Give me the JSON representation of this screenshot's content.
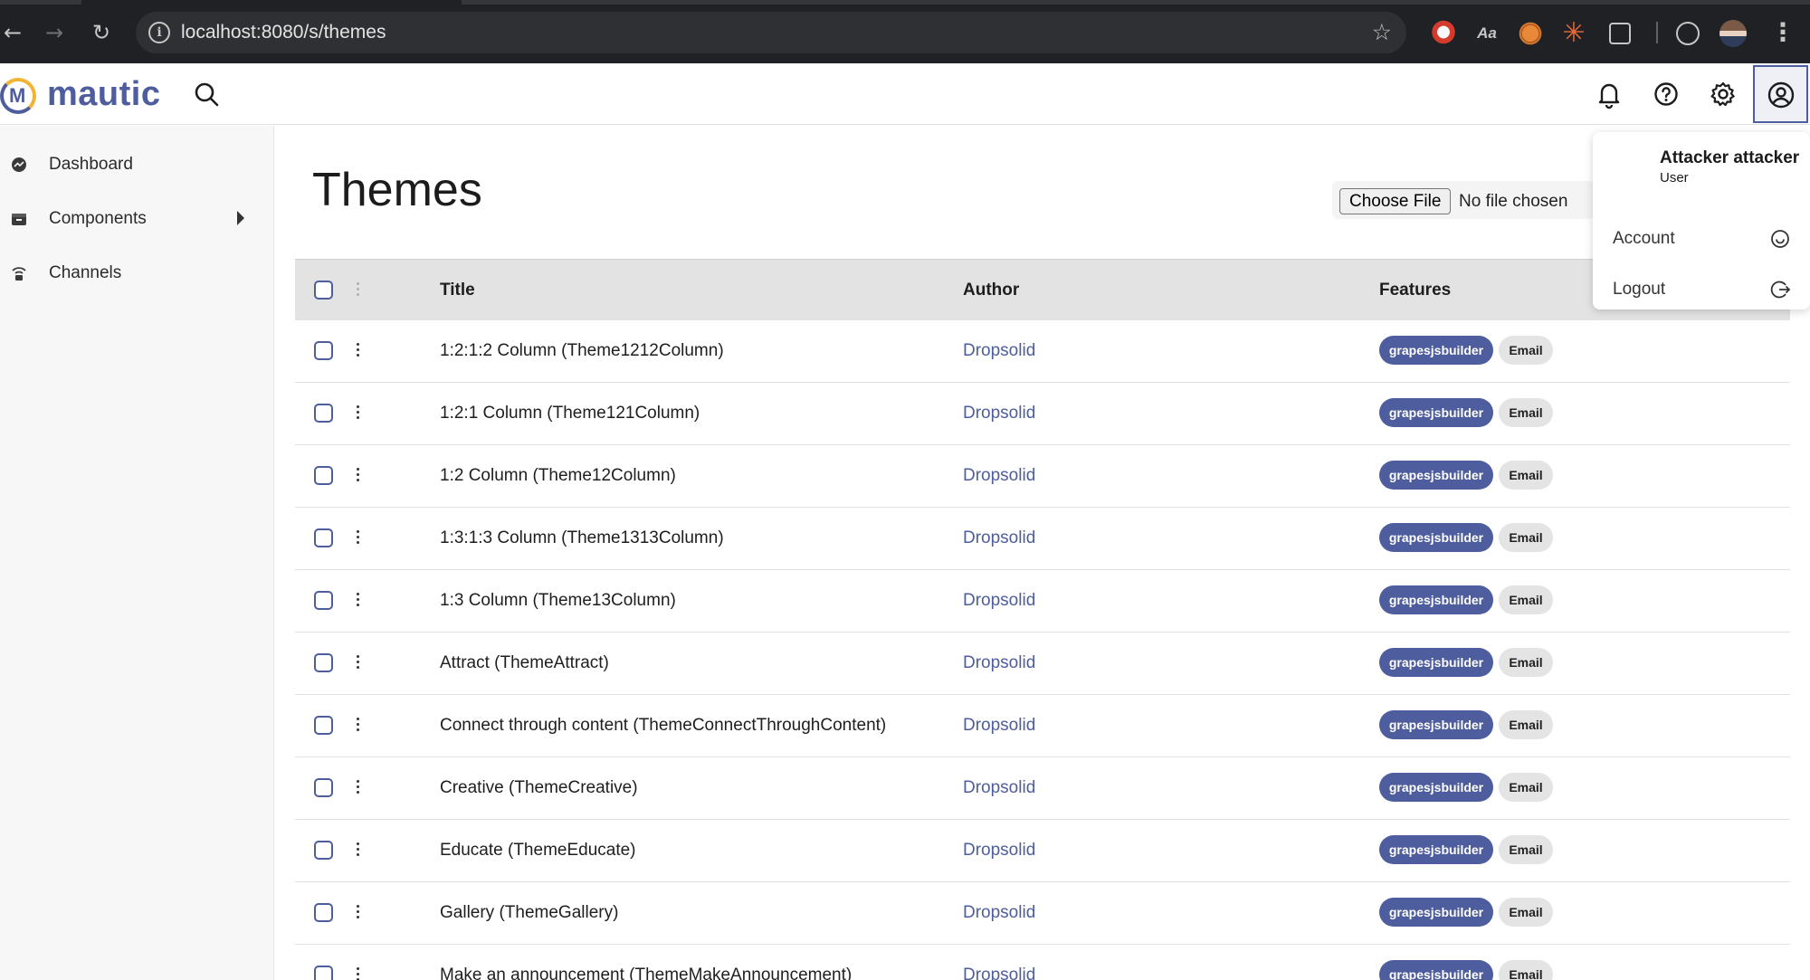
{
  "browser": {
    "url": "localhost:8080/s/themes"
  },
  "app": {
    "logo_text": "mautic"
  },
  "sidebar": {
    "items": [
      {
        "label": "Dashboard"
      },
      {
        "label": "Components"
      },
      {
        "label": "Channels"
      }
    ]
  },
  "page": {
    "title": "Themes"
  },
  "upload": {
    "button_label": "Choose File",
    "status": "No file chosen"
  },
  "table": {
    "columns": {
      "title": "Title",
      "author": "Author",
      "features": "Features"
    },
    "rows": [
      {
        "title": "1:2:1:2 Column (Theme1212Column)",
        "author": "Dropsolid",
        "features": [
          "grapesjsbuilder",
          "Email"
        ]
      },
      {
        "title": "1:2:1 Column (Theme121Column)",
        "author": "Dropsolid",
        "features": [
          "grapesjsbuilder",
          "Email"
        ]
      },
      {
        "title": "1:2 Column (Theme12Column)",
        "author": "Dropsolid",
        "features": [
          "grapesjsbuilder",
          "Email"
        ]
      },
      {
        "title": "1:3:1:3 Column (Theme1313Column)",
        "author": "Dropsolid",
        "features": [
          "grapesjsbuilder",
          "Email"
        ]
      },
      {
        "title": "1:3 Column (Theme13Column)",
        "author": "Dropsolid",
        "features": [
          "grapesjsbuilder",
          "Email"
        ]
      },
      {
        "title": "Attract (ThemeAttract)",
        "author": "Dropsolid",
        "features": [
          "grapesjsbuilder",
          "Email"
        ]
      },
      {
        "title": "Connect through content (ThemeConnectThroughContent)",
        "author": "Dropsolid",
        "features": [
          "grapesjsbuilder",
          "Email"
        ]
      },
      {
        "title": "Creative (ThemeCreative)",
        "author": "Dropsolid",
        "features": [
          "grapesjsbuilder",
          "Email"
        ]
      },
      {
        "title": "Educate (ThemeEducate)",
        "author": "Dropsolid",
        "features": [
          "grapesjsbuilder",
          "Email"
        ]
      },
      {
        "title": "Gallery (ThemeGallery)",
        "author": "Dropsolid",
        "features": [
          "grapesjsbuilder",
          "Email"
        ]
      },
      {
        "title": "Make an announcement (ThemeMakeAnnouncement)",
        "author": "Dropsolid",
        "features": [
          "grapesjsbuilder",
          "Email"
        ]
      }
    ]
  },
  "user_menu": {
    "name": "Attacker attacker",
    "role": "User",
    "items": [
      {
        "label": "Account",
        "icon": "smile-icon"
      },
      {
        "label": "Logout",
        "icon": "logout-icon"
      }
    ]
  },
  "colors": {
    "brand": "#4e5d9d",
    "brand_accent": "#f1b434",
    "badge_secondary": "#e4e4e4"
  }
}
